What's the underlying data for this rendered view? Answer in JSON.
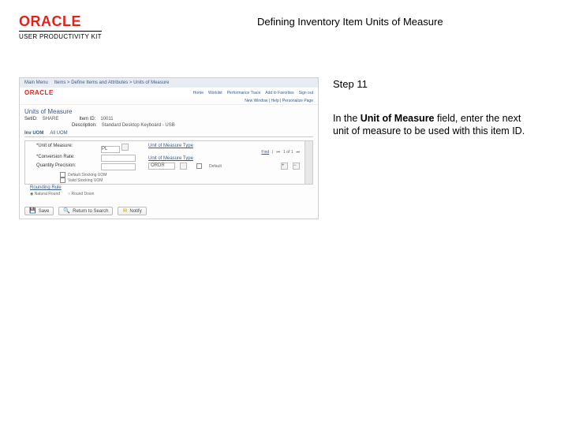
{
  "header": {
    "brand_word": "ORACLE",
    "brand_subline": "USER PRODUCTIVITY KIT",
    "doc_title": "Defining Inventory Item Units of Measure"
  },
  "screenshot": {
    "breadcrumb": {
      "root": "Main Menu",
      "path": "Items > Define Items and Attributes > Units of Measure"
    },
    "brandbar": {
      "word": "ORACLE",
      "nav": [
        "Home",
        "Worklist",
        "Performance Trace",
        "Add to Favorites",
        "Sign out"
      ]
    },
    "sublinks": "New Window | Help | Personalize Page",
    "page_title": "Units of Measure",
    "meta": {
      "setid_label": "SetID:",
      "setid_value": "SHARE",
      "itemid_label": "Item ID:",
      "itemid_value": "10011",
      "desc_label": "Description:",
      "desc_value": "Standard Desktop Keyboard - USB"
    },
    "tabs": {
      "tab1": "Inv UOM",
      "tab2": "All UOM"
    },
    "form": {
      "uom_label": "*Unit of Measure:",
      "uom_value": "PL",
      "conv_label": "*Conversion Rate:",
      "conv_value": "",
      "qprec_label": "Quantity Precision:",
      "qprec_value": "",
      "default_stock_label": "Default Stocking UOM",
      "valid_stock_label": "Valid Stocking UOM"
    },
    "right_panel": {
      "uom_type_label": "Unit of Measure Type",
      "find": "Find",
      "type": "ORDR",
      "default": "Default"
    },
    "rounding": {
      "heading": "Rounding Rule",
      "opt_natural": "Natural Round",
      "opt_down": "Round Down"
    },
    "buttons": {
      "save": "Save",
      "return": "Return to Search",
      "notify": "Notify"
    }
  },
  "tutorial": {
    "step_label": "Step 11",
    "instruction_prefix": "In the ",
    "instruction_bold": "Unit of Measure",
    "instruction_suffix": " field, enter the next unit of measure to be used with this item ID."
  }
}
